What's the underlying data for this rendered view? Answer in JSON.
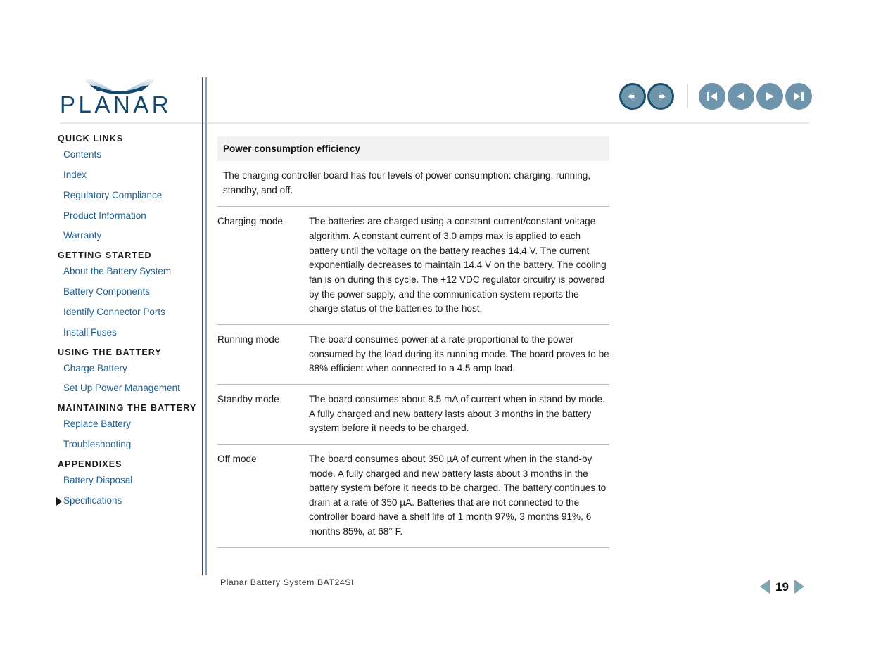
{
  "brand": {
    "name": "PLANAR",
    "logo_color": "#13496e"
  },
  "topnav": {
    "buttons": [
      {
        "name": "back-button",
        "icon": "arrow-left-icon",
        "style": "ringed"
      },
      {
        "name": "forward-button",
        "icon": "arrow-right-icon",
        "style": "ringed"
      },
      {
        "name": "first-page-button",
        "icon": "skip-to-start-icon",
        "style": "flat"
      },
      {
        "name": "previous-page-button",
        "icon": "triangle-left-icon",
        "style": "flat"
      },
      {
        "name": "next-page-button",
        "icon": "triangle-right-icon",
        "style": "flat"
      },
      {
        "name": "last-page-button",
        "icon": "skip-to-end-icon",
        "style": "flat"
      }
    ],
    "accent_color": "#6e95ab",
    "ring_color": "#1b5070"
  },
  "sidebar": {
    "groups": [
      {
        "heading": "QUICK LINKS",
        "items": [
          {
            "label": "Contents",
            "current": false
          },
          {
            "label": "Index",
            "current": false
          },
          {
            "label": "Regulatory Compliance",
            "current": false
          },
          {
            "label": "Product Information",
            "current": false
          },
          {
            "label": "Warranty",
            "current": false
          }
        ]
      },
      {
        "heading": "GETTING STARTED",
        "items": [
          {
            "label": "About the Battery System",
            "current": false
          },
          {
            "label": "Battery Components",
            "current": false
          },
          {
            "label": "Identify Connector Ports",
            "current": false
          },
          {
            "label": "Install Fuses",
            "current": false
          }
        ]
      },
      {
        "heading": "USING THE BATTERY",
        "items": [
          {
            "label": "Charge Battery",
            "current": false
          },
          {
            "label": "Set Up Power Management",
            "current": false
          }
        ]
      },
      {
        "heading": "MAINTAINING THE BATTERY",
        "items": [
          {
            "label": "Replace Battery",
            "current": false
          },
          {
            "label": "Troubleshooting",
            "current": false
          }
        ]
      },
      {
        "heading": "APPENDIXES",
        "items": [
          {
            "label": "Battery Disposal",
            "current": false
          },
          {
            "label": "Specifications",
            "current": true
          }
        ]
      }
    ],
    "link_color": "#1d6193"
  },
  "main": {
    "section_title": "Power consumption efficiency",
    "intro": "The charging controller board has four levels of power consumption: charging, running, standby, and off.",
    "rows": [
      {
        "mode": "Charging mode",
        "indented": false,
        "description": "The batteries are charged using a constant current/constant voltage algorithm. A constant current of 3.0 amps max is applied to each battery until the voltage on the battery reaches 14.4 V. The current exponentially decreases to maintain 14.4 V on the battery. The cooling fan is on during this cycle. The +12 VDC regulator circuitry is powered by the power supply, and the communication system reports the charge status of the batteries to the host."
      },
      {
        "mode": "Running mode",
        "indented": true,
        "description": "The board consumes power at a rate proportional to the power consumed by the load during its running mode. The board proves to be 88% efficient when connected to a 4.5 amp load."
      },
      {
        "mode": "Standby mode",
        "indented": false,
        "description": "The board consumes about 8.5 mA of current when in stand-by mode. A fully charged and new battery lasts about 3 months in the battery system before it needs to be charged."
      },
      {
        "mode": "Off mode",
        "indented": false,
        "description": "The board consumes about 350 µA of current when in the stand-by mode. A fully charged and new battery lasts about 3 months in the battery system before it needs to be charged. The battery continues to drain at a rate of 350 µA. Batteries that are not connected to the controller board have a shelf life of 1 month 97%, 3 months 91%, 6 months 85%, at 68° F."
      }
    ]
  },
  "footer": {
    "document_title": "Planar Battery System BAT24SI",
    "page_number": "19"
  }
}
